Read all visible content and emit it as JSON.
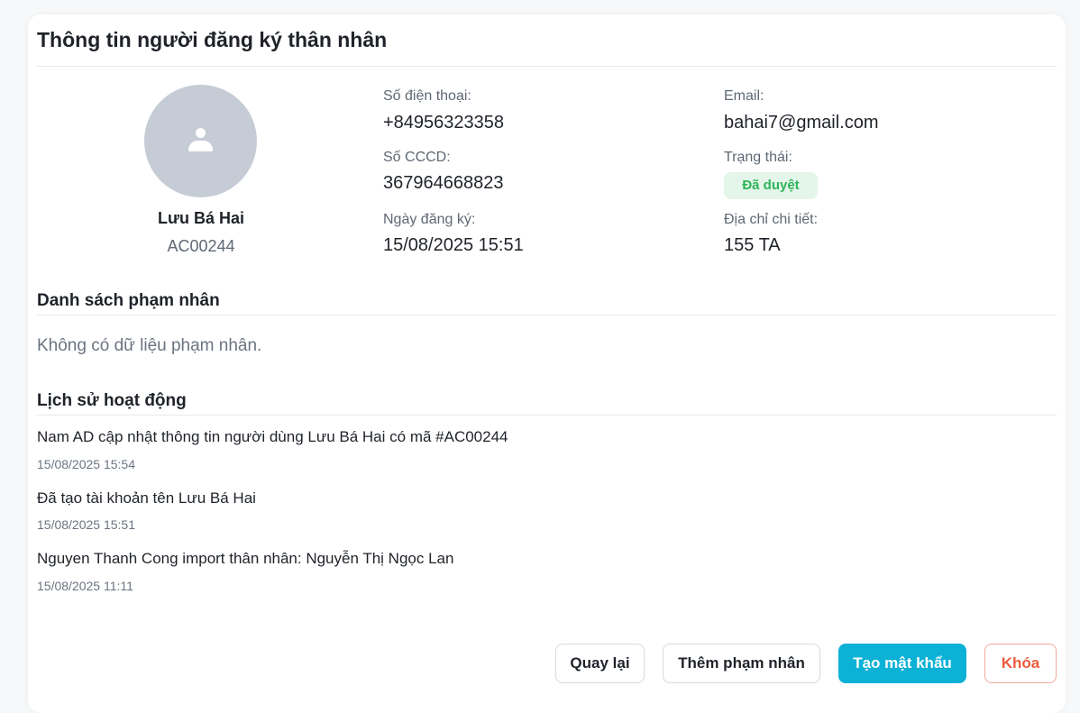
{
  "page": {
    "title": "Thông tin người đăng ký thân nhân"
  },
  "profile": {
    "avatar_icon": "user-icon",
    "name": "Lưu Bá Hai",
    "code": "AC00244"
  },
  "fields": {
    "phone_label": "Số điện thoại:",
    "phone_value": "+84956323358",
    "cccd_label": "Số CCCD:",
    "cccd_value": "367964668823",
    "registered_label": "Ngày đăng ký:",
    "registered_value": "15/08/2025 15:51",
    "email_label": "Email:",
    "email_value": "bahai7@gmail.com",
    "status_label": "Trạng thái:",
    "status_value": "Đã duyệt",
    "address_label": "Địa chỉ chi tiết:",
    "address_value": "155 TA"
  },
  "prisoners": {
    "title": "Danh sách phạm nhân",
    "empty": "Không có dữ liệu phạm nhân."
  },
  "history": {
    "title": "Lịch sử hoạt động",
    "items": [
      {
        "text": "Nam AD cập nhật thông tin người dùng Lưu Bá Hai có mã #AC00244",
        "time": "15/08/2025 15:54"
      },
      {
        "text": "Đã tạo tài khoản tên Lưu Bá Hai",
        "time": "15/08/2025 15:51"
      },
      {
        "text": "Nguyen Thanh Cong import thân nhân: Nguyễn Thị Ngọc Lan",
        "time": "15/08/2025 11:11"
      }
    ]
  },
  "actions": {
    "back": "Quay lại",
    "add_prisoner": "Thêm phạm nhân",
    "create_password": "Tạo mật khẩu",
    "lock": "Khóa"
  },
  "colors": {
    "primary": "#0cb1d6",
    "danger": "#ee5b3e",
    "success": "#2fb45a",
    "success_bg": "#e3f6e9",
    "avatar_bg": "#c6ccd5"
  }
}
